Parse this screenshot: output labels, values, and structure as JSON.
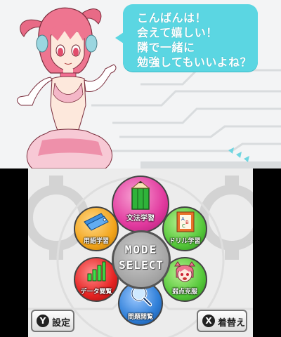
{
  "top_screen": {
    "speech_bubble": {
      "lines": [
        "こんばんは！",
        "会えて嬉しい！",
        "隣で一緒に",
        "勉強してもいいよね？"
      ]
    }
  },
  "bottom_screen": {
    "center": {
      "line1": "MODE",
      "line2": "SELECT"
    },
    "modes": {
      "grammar": {
        "label": "文法学習",
        "icon": "green-pencil-icon",
        "color": "#e23a9f"
      },
      "terms": {
        "label": "用語学習",
        "icon": "blue-cards-icon",
        "color": "#f3a51c"
      },
      "drill": {
        "label": "ドリル学習",
        "icon": "abc-book-icon",
        "color": "#55c83a"
      },
      "data": {
        "label": "データ閲覧",
        "icon": "bar-chart-icon",
        "color": "#e52322"
      },
      "weakness": {
        "label": "弱点克服",
        "icon": "character-face-icon",
        "color": "#55c83a"
      },
      "questions": {
        "label": "問題閲覧",
        "icon": "magnifier-icon",
        "color": "#2f7fd8"
      }
    },
    "settings_button": {
      "key": "Y",
      "label": "設定"
    },
    "dressup_button": {
      "key": "X",
      "label": "着替え"
    }
  }
}
